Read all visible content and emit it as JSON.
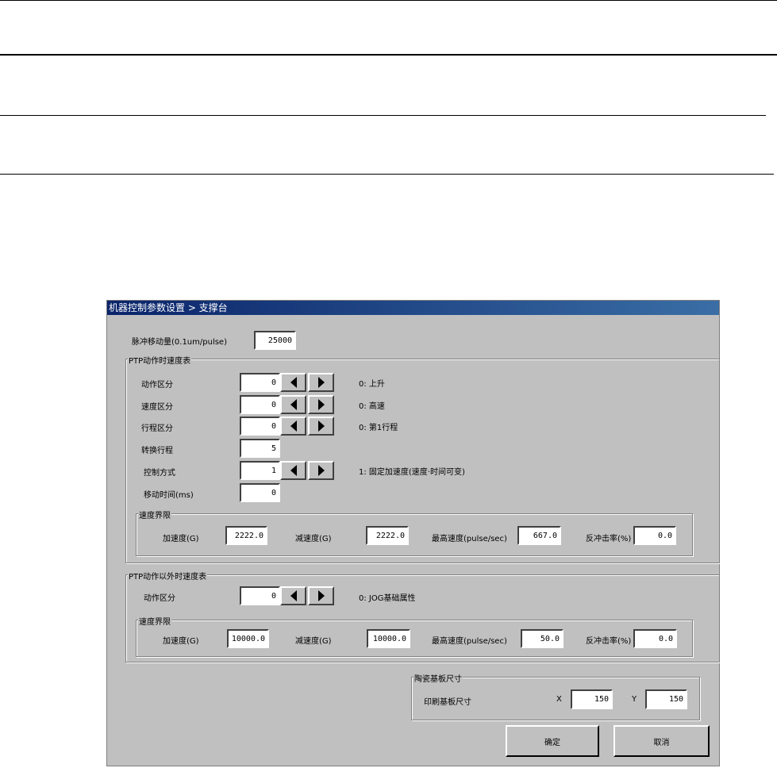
{
  "dialog": {
    "title": "机器控制参数设置 > 支撑台",
    "pulse": {
      "label": "脉冲移动量(0.1um/pulse)",
      "value": "25000"
    },
    "ptp": {
      "title": "PTP动作时速度表",
      "rows": [
        {
          "label": "动作区分",
          "value": "0",
          "desc": "0: 上升"
        },
        {
          "label": "速度区分",
          "value": "0",
          "desc": "0: 高速"
        },
        {
          "label": "行程区分",
          "value": "0",
          "desc": "0: 第1行程"
        },
        {
          "label": "转换行程",
          "value": "5"
        },
        {
          "label": "控制方式",
          "value": "1",
          "desc": "1: 固定加速度(速度·时间可变)"
        },
        {
          "label": "移动时间(ms)",
          "value": "0"
        }
      ],
      "limits": {
        "title": "速度界限",
        "accel_label": "加速度(G)",
        "accel": "2222.0",
        "decel_label": "减速度(G)",
        "decel": "2222.0",
        "maxspeed_label": "最高速度(pulse/sec)",
        "maxspeed": "667.0",
        "rebound_label": "反冲击率(%)",
        "rebound": "0.0"
      }
    },
    "nonptp": {
      "title": "PTP动作以外时速度表",
      "row": {
        "label": "动作区分",
        "value": "0",
        "desc": "0: JOG基础属性"
      },
      "limits": {
        "title": "速度界限",
        "accel_label": "加速度(G)",
        "accel": "10000.0",
        "decel_label": "减速度(G)",
        "decel": "10000.0",
        "maxspeed_label": "最高速度(pulse/sec)",
        "maxspeed": "50.0",
        "rebound_label": "反冲击率(%)",
        "rebound": "0.0"
      }
    },
    "substrate": {
      "title": "陶瓷基板尺寸",
      "label": "印刷基板尺寸",
      "x_label": "X",
      "x": "150",
      "y_label": "Y",
      "y": "150"
    },
    "ok": "确定",
    "cancel": "取消"
  }
}
